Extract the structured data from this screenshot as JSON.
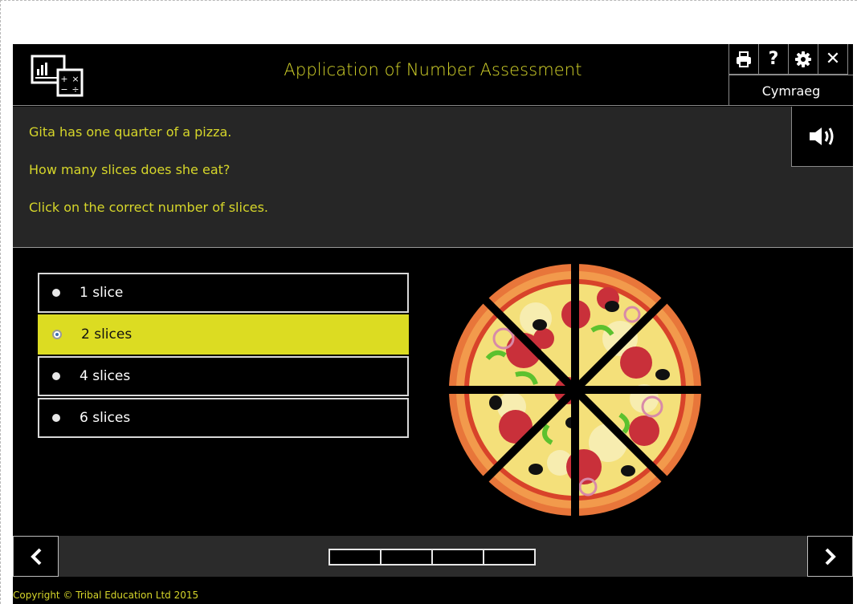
{
  "header": {
    "title": "Application of Number Assessment",
    "logo_icon": "calculator-chart-icon",
    "tools": [
      {
        "name": "print",
        "icon": "printer-icon"
      },
      {
        "name": "help",
        "icon": "question-icon",
        "glyph": "?"
      },
      {
        "name": "settings",
        "icon": "gear-icon"
      },
      {
        "name": "close",
        "icon": "close-icon",
        "glyph": "✕"
      }
    ],
    "language_label": "Cymraeg"
  },
  "question": {
    "lines": [
      "Gita has one quarter of a pizza.",
      "How many slices does she eat?",
      "Click on the correct number of slices."
    ],
    "audio_icon": "speaker-icon"
  },
  "answers": [
    {
      "label": "1 slice",
      "selected": false
    },
    {
      "label": "2 slices",
      "selected": true
    },
    {
      "label": "4 slices",
      "selected": false
    },
    {
      "label": "6 slices",
      "selected": false
    }
  ],
  "illustration": {
    "icon": "pizza-illustration",
    "slices": 8
  },
  "navigation": {
    "prev_icon": "chevron-left-icon",
    "next_icon": "chevron-right-icon",
    "progress_segments": 4,
    "progress_completed": 0
  },
  "footer": {
    "copyright": "Copyright © Tribal Education Ltd 2015"
  },
  "colors": {
    "accent": "#d6d62a",
    "selected": "#dcdc22",
    "background": "#000000",
    "panel": "#262626"
  }
}
